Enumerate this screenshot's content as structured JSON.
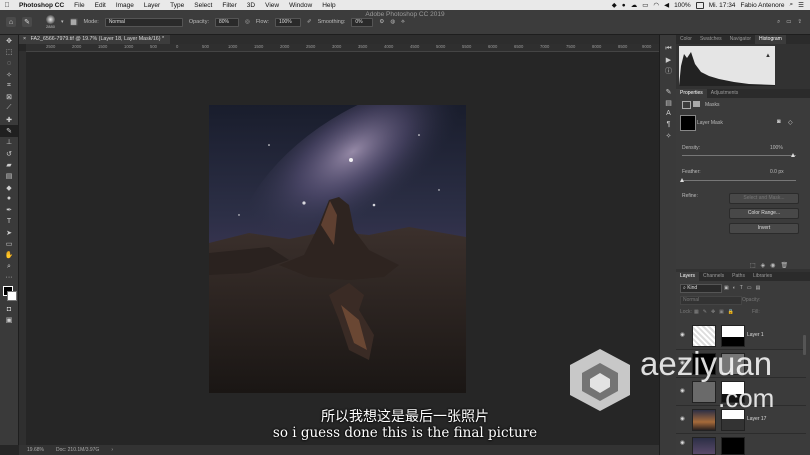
{
  "menubar": {
    "app": "Photoshop CC",
    "items": [
      "File",
      "Edit",
      "Image",
      "Layer",
      "Type",
      "Select",
      "Filter",
      "3D",
      "View",
      "Window",
      "Help"
    ],
    "battery": "100%",
    "clock": "Mi. 17:34",
    "user": "Fabio Antenore"
  },
  "window_title": "Adobe Photoshop CC 2019",
  "options": {
    "brush_size": "2880",
    "mode_label": "Mode:",
    "mode_value": "Normal",
    "opacity_label": "Opacity:",
    "opacity_value": "80%",
    "flow_label": "Flow:",
    "flow_value": "100%",
    "smoothing_label": "Smoothing:",
    "smoothing_value": "0%"
  },
  "document": {
    "tab": "FA2_6566-7979.tif @ 19.7% (Layer 18, Layer Mask/16) *",
    "ruler_ticks": [
      "2500",
      "2000",
      "1500",
      "1000",
      "500",
      "0",
      "500",
      "1000",
      "1500",
      "2000",
      "2500",
      "3000",
      "3500",
      "4000",
      "4500",
      "5000",
      "5500",
      "6000",
      "6500",
      "7000",
      "7500",
      "8000",
      "8500",
      "9000"
    ],
    "zoom": "19.68%",
    "doc_info": "Doc: 210.1M/3.97G"
  },
  "panels": {
    "top_tabs": [
      "Color",
      "Swatches",
      "Navigator",
      "Histogram"
    ],
    "properties_tabs": [
      "Properties",
      "Adjustments"
    ],
    "masks_label": "Masks",
    "layer_mask_label": "Layer Mask",
    "density_label": "Density:",
    "density_value": "100%",
    "feather_label": "Feather:",
    "feather_value": "0.0 px",
    "refine_label": "Refine:",
    "select_mask": "Select and Mask...",
    "color_range": "Color Range...",
    "invert": "Invert",
    "layers_tabs": [
      "Layers",
      "Channels",
      "Paths",
      "Libraries"
    ],
    "kind_label": "Kind",
    "blend_mode": "Normal",
    "opacity_label": "Opacity:",
    "lock_label": "Lock:",
    "fill_label": "Fill:",
    "layers": [
      "Layer 1",
      "",
      "",
      "Layer 17"
    ]
  },
  "subtitles": {
    "zh": "所以我想这是最后一张照片",
    "en": "so i guess done this is the final picture"
  },
  "watermark": {
    "line1": "aeziyuan",
    "line2": ".com"
  }
}
